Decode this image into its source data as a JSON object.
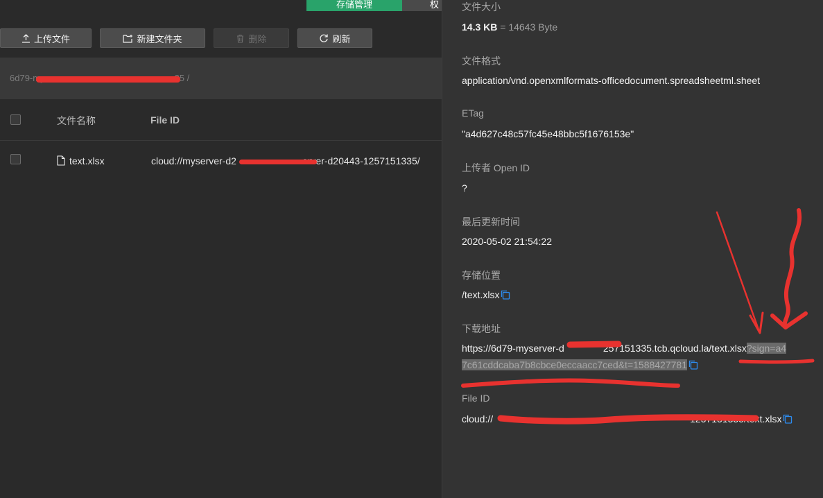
{
  "tabs": [
    {
      "label": "存储管理",
      "active": true
    },
    {
      "label": "权",
      "active": false
    }
  ],
  "toolbar": {
    "upload_label": "上传文件",
    "new_folder_label": "新建文件夹",
    "delete_label": "删除",
    "refresh_label": "刷新"
  },
  "path": {
    "prefix": "6d79-my",
    "suffix": "35 /"
  },
  "table": {
    "columns": [
      "文件名称",
      "File ID"
    ],
    "rows": [
      {
        "name": "text.xlsx",
        "file_id_start": "cloud://myserver-d2",
        "file_id_end": "erver-d20443-1257151335/"
      }
    ]
  },
  "detail": {
    "size_label": "文件大小",
    "size_value": "14.3 KB",
    "size_bytes": "= 14643 Byte",
    "format_label": "文件格式",
    "format_value": "application/vnd.openxmlformats-officedocument.spreadsheetml.sheet",
    "etag_label": "ETag",
    "etag_value": "\"a4d627c48c57fc45e48bbc5f1676153e\"",
    "uploader_label": "上传者 Open ID",
    "uploader_value": "?",
    "updated_label": "最后更新时间",
    "updated_value": "2020-05-02 21:54:22",
    "location_label": "存储位置",
    "location_value": "/text.xlsx",
    "download_label": "下载地址",
    "download_url_start": "https://6d79-myserver-d",
    "download_url_mid": "257151335.tcb.qcloud.la/text.xlsx",
    "download_sign_line1": "?sign=a4",
    "download_sign_line2": "7c61cddcaba7b8cbce0eccaacc7ced&t=1588427781",
    "fileid_label": "File ID",
    "fileid_start": "cloud://",
    "fileid_end": "1257151335/text.xlsx"
  },
  "colors": {
    "accent": "#29a36a",
    "annotation": "#e8322f",
    "copy_icon": "#2d8cf0"
  },
  "icons": [
    "upload-icon",
    "new-folder-icon",
    "trash-icon",
    "refresh-icon",
    "file-icon",
    "copy-icon"
  ]
}
